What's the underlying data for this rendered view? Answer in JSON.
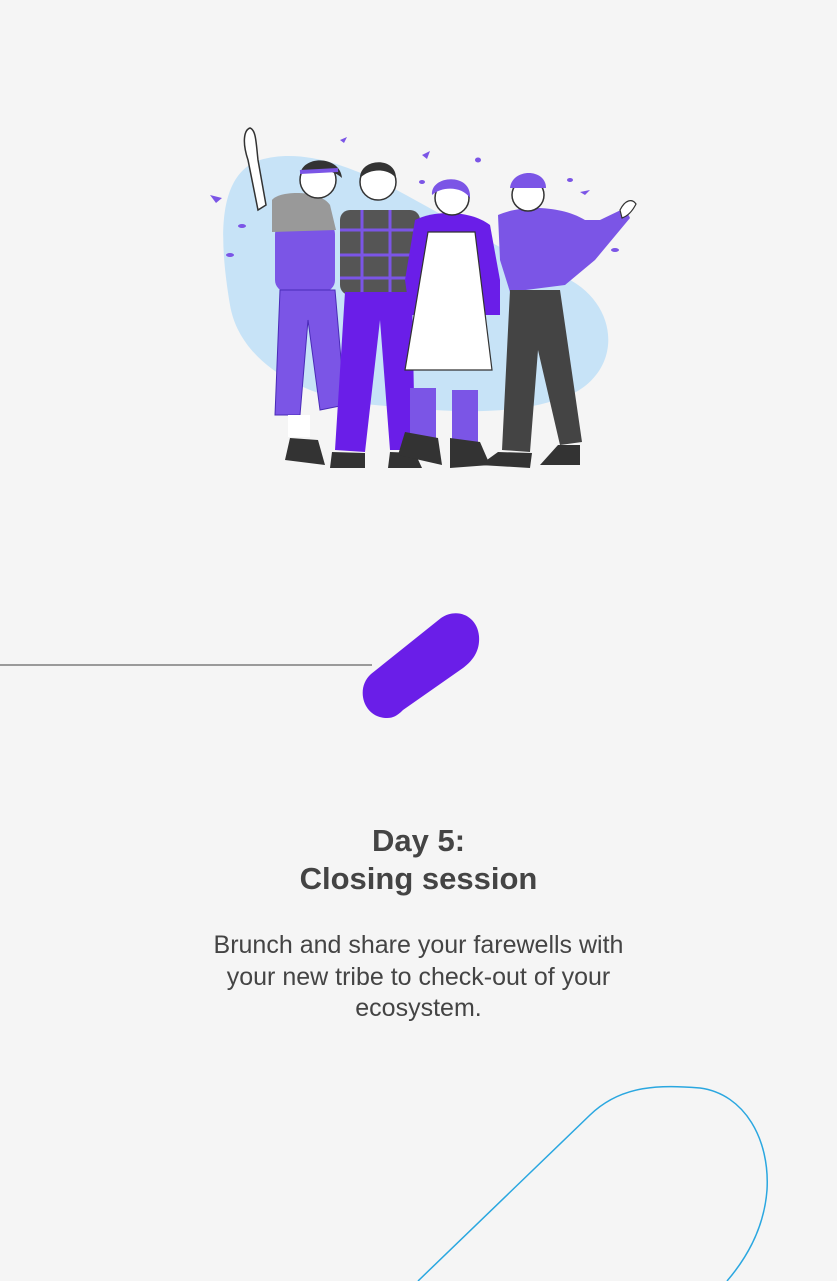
{
  "illustration": {
    "name": "friends-group-illustration"
  },
  "step": {
    "day": "Day 5:",
    "title": "Closing session",
    "description": "Brunch and share your farewells with your new tribe to check-out of your ecosystem."
  },
  "colors": {
    "background": "#f5f5f5",
    "accent": "#6a1ee8",
    "figure_purple": "#7b55e6",
    "blob_blue": "#c7e3f7",
    "text": "#444444",
    "outline_blue": "#2aa7e0"
  }
}
